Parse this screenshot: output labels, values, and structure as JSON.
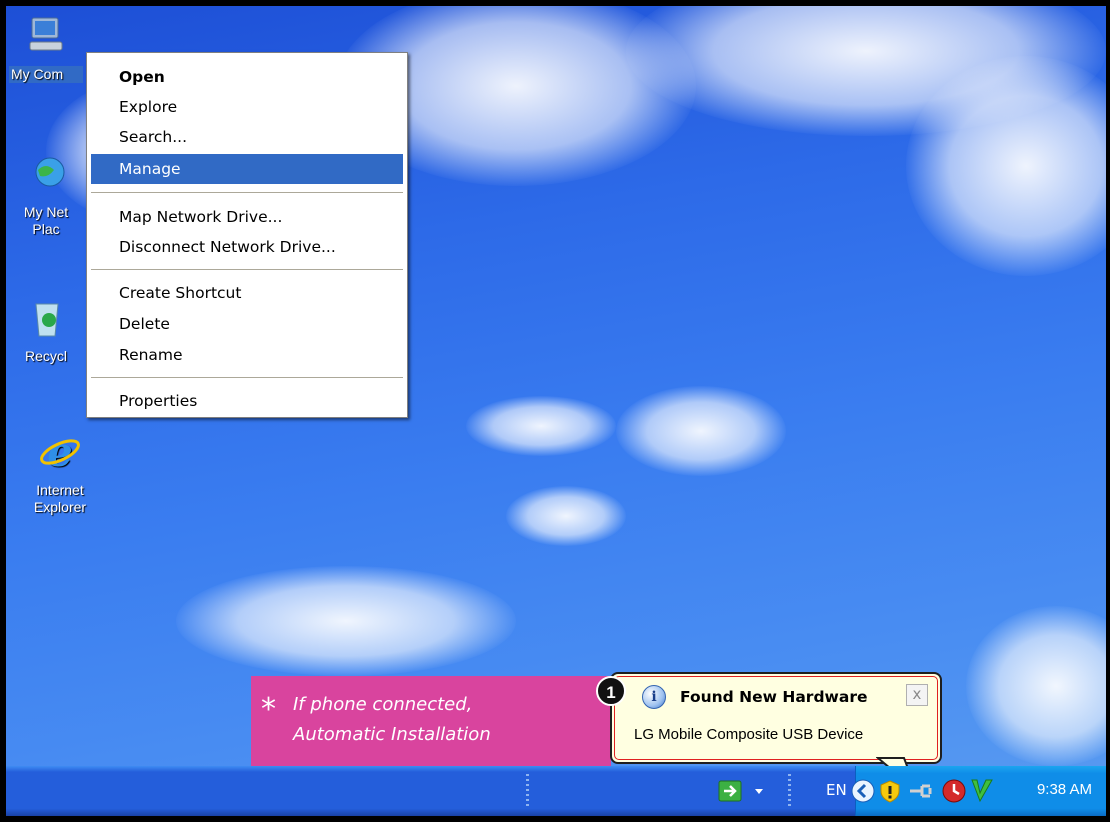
{
  "desktop": {
    "icons": [
      {
        "name": "my-computer",
        "label": "My Com",
        "icon": "computer-icon"
      },
      {
        "name": "my-network-places",
        "label": "My Net\nPlac",
        "icon": "network-icon"
      },
      {
        "name": "recycle-bin",
        "label": "Recycl",
        "icon": "recycle-bin-icon"
      },
      {
        "name": "internet-explorer",
        "label": "Internet\nExplorer",
        "icon": "ie-icon"
      }
    ]
  },
  "context_menu": {
    "open": "Open",
    "explore": "Explore",
    "search": "Search...",
    "manage": "Manage",
    "map_drive": "Map Network Drive...",
    "disconnect_drive": "Disconnect Network Drive...",
    "create_shortcut": "Create Shortcut",
    "delete": "Delete",
    "rename": "Rename",
    "properties": "Properties",
    "selected": "Manage"
  },
  "callout": {
    "star": "*",
    "line1": "If phone connected,",
    "line2": "Automatic Installation"
  },
  "step_badge": "1",
  "balloon": {
    "title": "Found New Hardware",
    "message": "LG Mobile Composite USB Device",
    "close": "x",
    "icon": "info-icon"
  },
  "taskbar": {
    "language": "EN",
    "clock": "9:38 AM",
    "tray_icons": [
      "show-desktop-arrow-icon",
      "back-arrow-icon",
      "security-shield-icon",
      "usb-plug-icon",
      "red-power-icon",
      "green-v-icon"
    ]
  },
  "colors": {
    "menu_selection": "#316ac5",
    "callout_pink": "#d9449e",
    "balloon_bg": "#ffffe1",
    "taskbar_blue": "#245edb"
  }
}
